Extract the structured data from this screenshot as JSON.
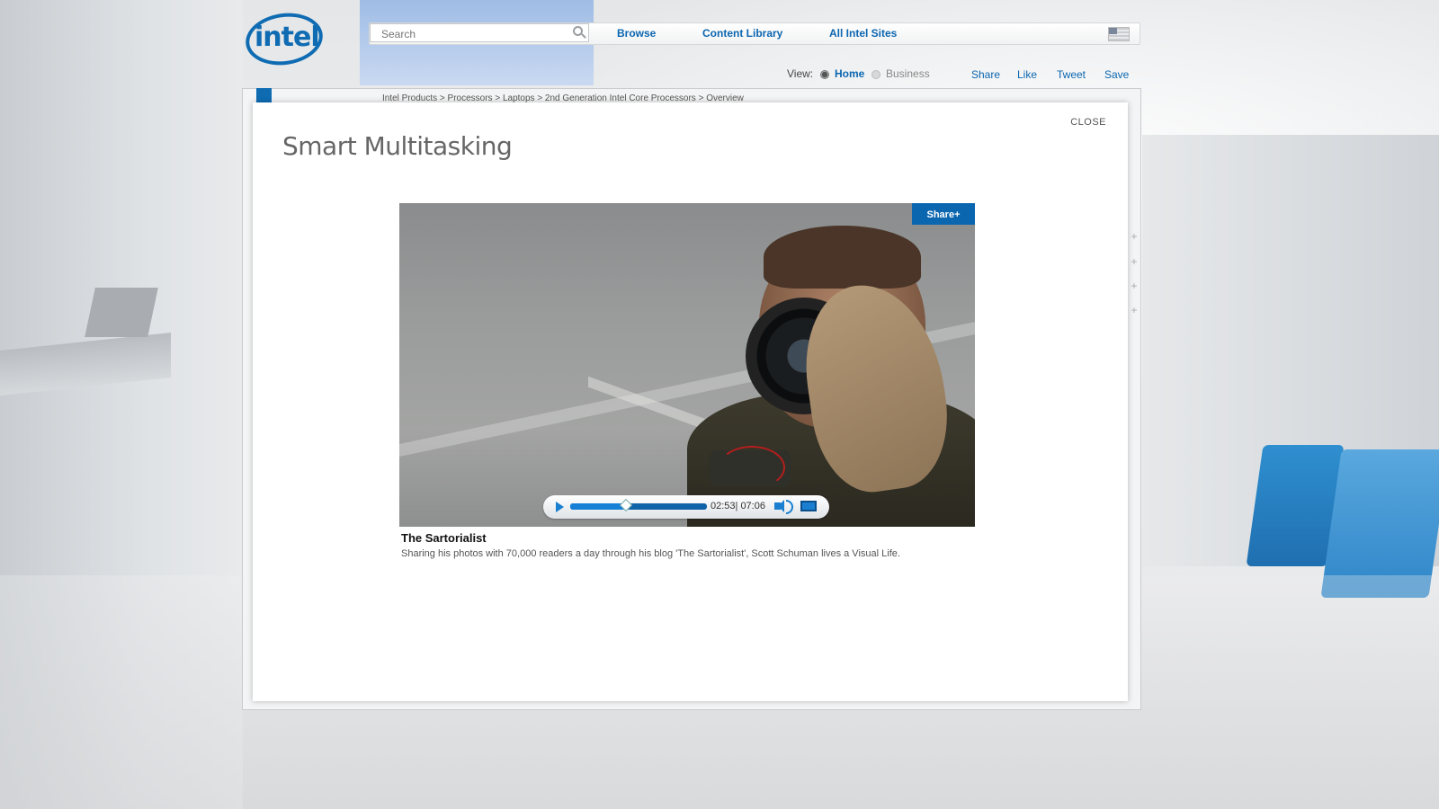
{
  "header": {
    "search": {
      "placeholder": "Search",
      "value": ""
    },
    "nav": [
      "Browse",
      "Content Library",
      "All Intel Sites"
    ],
    "logo_text": "intel"
  },
  "view_toggle": {
    "label": "View:",
    "options": [
      {
        "label": "Home",
        "selected": true
      },
      {
        "label": "Business",
        "selected": false
      }
    ]
  },
  "actions": [
    "Share",
    "Like",
    "Tweet",
    "Save"
  ],
  "breadcrumb": "Intel Products > Processors > Laptops > 2nd Generation Intel Core Processors > Overview",
  "modal": {
    "close_label": "CLOSE",
    "title": "Smart Multitasking",
    "video": {
      "share_label": "Share+",
      "current_time": "02:53",
      "duration": "07:06",
      "time_display": "02:53| 07:06",
      "progress_fraction": 0.406,
      "title": "The Sartorialist",
      "description": "Sharing his photos with 70,000 readers a day through his blog 'The Sartorialist', Scott Schuman lives a Visual Life."
    }
  },
  "colors": {
    "brand_blue": "#0b66b0",
    "modal_bg": "#ffffff",
    "page_bg": "#e9eaeb"
  }
}
